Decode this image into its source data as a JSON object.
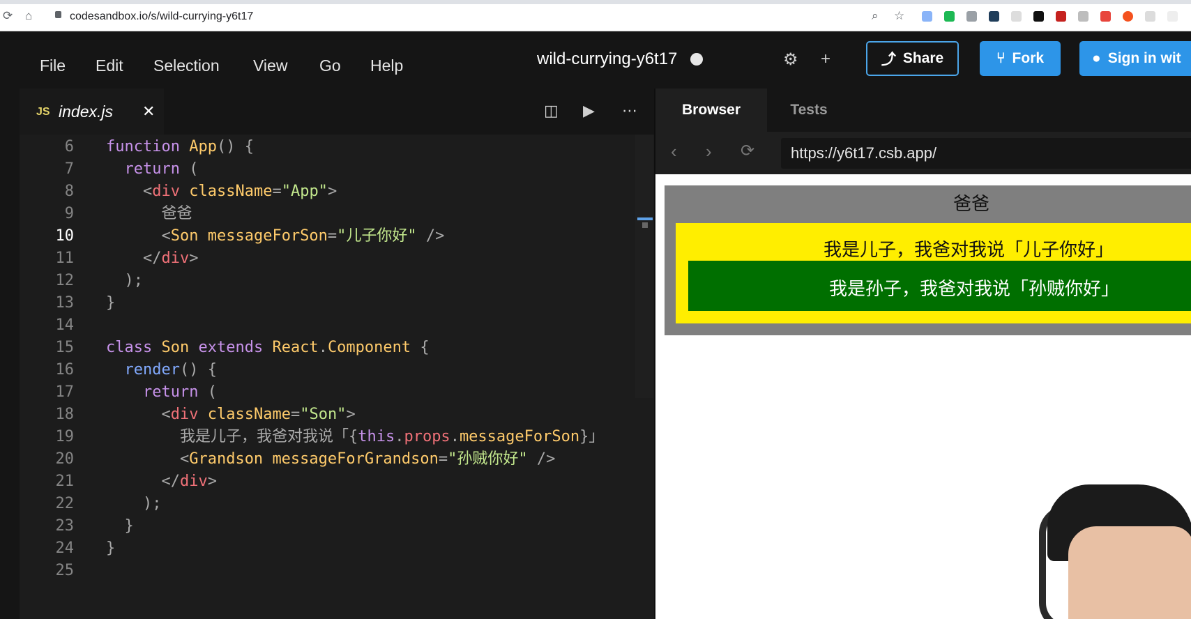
{
  "browser": {
    "url": "codesandbox.io/s/wild-currying-y6t17"
  },
  "header": {
    "menu": [
      "File",
      "Edit",
      "Selection",
      "View",
      "Go",
      "Help"
    ],
    "sandbox_title": "wild-currying-y6t17",
    "share_label": "Share",
    "fork_label": "Fork",
    "signin_label": "Sign in wit"
  },
  "editor": {
    "file_tab": {
      "badge": "JS",
      "name": "index.js"
    },
    "active_line": 10,
    "lines": [
      {
        "n": "6",
        "text": "function App() {"
      },
      {
        "n": "7",
        "text": "  return ("
      },
      {
        "n": "8",
        "text": "    <div className=\"App\">"
      },
      {
        "n": "9",
        "text": "      爸爸"
      },
      {
        "n": "10",
        "text": "      <Son messageForSon=\"儿子你好\" />"
      },
      {
        "n": "11",
        "text": "    </div>"
      },
      {
        "n": "12",
        "text": "  );"
      },
      {
        "n": "13",
        "text": "}"
      },
      {
        "n": "14",
        "text": ""
      },
      {
        "n": "15",
        "text": "class Son extends React.Component {"
      },
      {
        "n": "16",
        "text": "  render() {"
      },
      {
        "n": "17",
        "text": "    return ("
      },
      {
        "n": "18",
        "text": "      <div className=\"Son\">"
      },
      {
        "n": "19",
        "text": "        我是儿子，我爸对我说「{this.props.messageForSon}」"
      },
      {
        "n": "20",
        "text": "        <Grandson messageForGrandson=\"孙贼你好\" />"
      },
      {
        "n": "21",
        "text": "      </div>"
      },
      {
        "n": "22",
        "text": "    );"
      },
      {
        "n": "23",
        "text": "  }"
      },
      {
        "n": "24",
        "text": "}"
      },
      {
        "n": "25",
        "text": ""
      }
    ]
  },
  "preview": {
    "tabs": [
      "Browser",
      "Tests"
    ],
    "address": "https://y6t17.csb.app/",
    "app_text": "爸爸",
    "son_text": "我是儿子，我爸对我说「儿子你好」",
    "grandson_text": "我是孙子，我爸对我说「孙贼你好」",
    "colors": {
      "app_bg": "#7f7f7f",
      "son_bg": "#ffee00",
      "grandson_bg": "#006f00"
    }
  }
}
